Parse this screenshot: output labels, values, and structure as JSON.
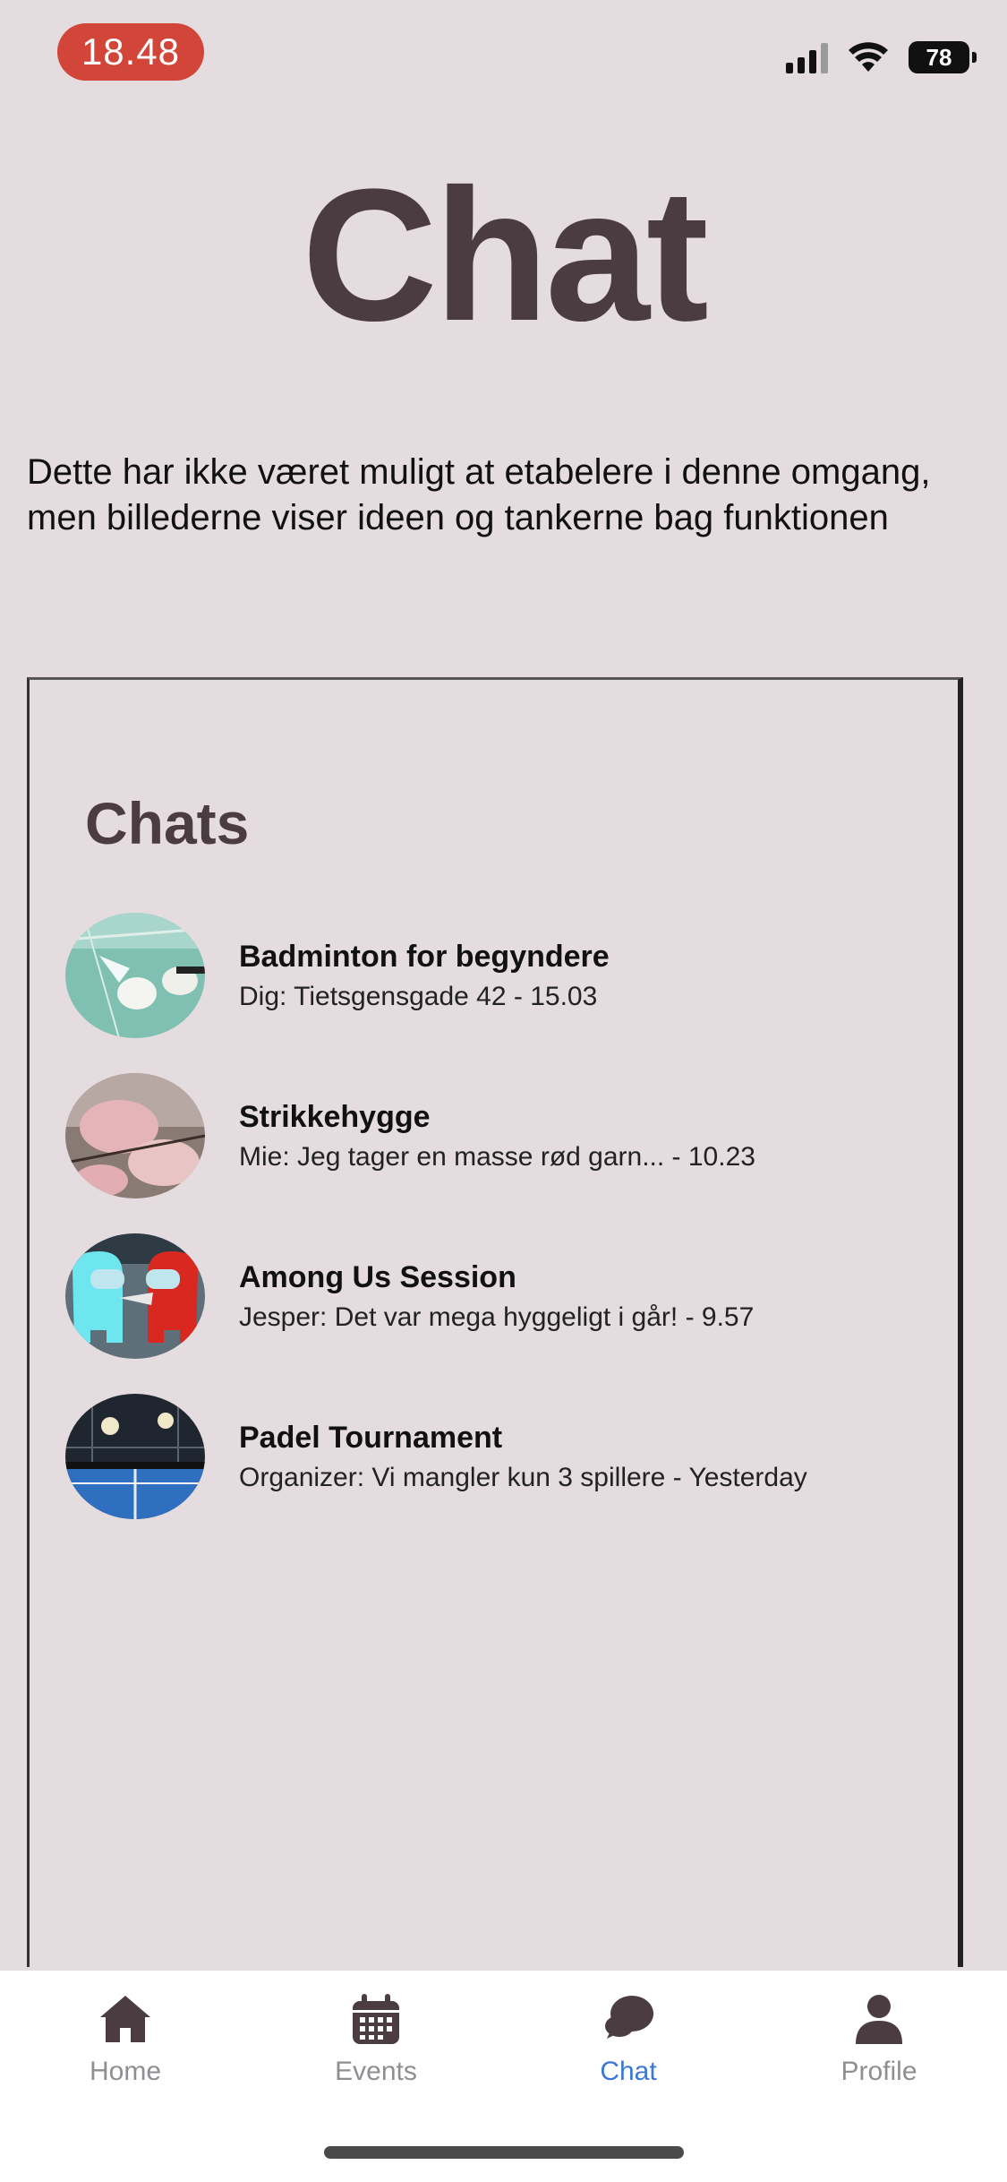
{
  "status_bar": {
    "time": "18.48",
    "battery": "78"
  },
  "page": {
    "title": "Chat",
    "intro": "Dette har ikke været muligt at etabelere i denne omgang, men billederne viser ideen og tankerne bag funktionen"
  },
  "embedded": {
    "heading": "Chats",
    "chats": [
      {
        "name": "Badminton for begyndere",
        "preview": "Dig: Tietsgensgade 42 - 15.03",
        "icon": "badminton-shuttlecock-image"
      },
      {
        "name": "Strikkehygge",
        "preview": "Mie: Jeg tager en masse rød garn... - 10.23",
        "icon": "knitting-yarn-image"
      },
      {
        "name": "Among Us Session",
        "preview": "Jesper: Det var mega hyggeligt i går! - 9.57",
        "icon": "among-us-characters-image"
      },
      {
        "name": "Padel Tournament",
        "preview": "Organizer: Vi mangler kun 3 spillere - Yesterday",
        "icon": "padel-court-image"
      }
    ]
  },
  "tab_bar": {
    "tabs": [
      {
        "label": "Home",
        "icon": "house-icon"
      },
      {
        "label": "Events",
        "icon": "calendar-icon"
      },
      {
        "label": "Chat",
        "icon": "chat-bubbles-icon"
      },
      {
        "label": "Profile",
        "icon": "person-icon"
      }
    ],
    "active": "Chat"
  },
  "colors": {
    "background": "#e4dcde",
    "title": "#4a3c41",
    "time_pill": "#d2463a",
    "active_tab": "#3a78d4",
    "inactive_tab": "#8e8e93",
    "icon_dark": "#4a3c41"
  }
}
